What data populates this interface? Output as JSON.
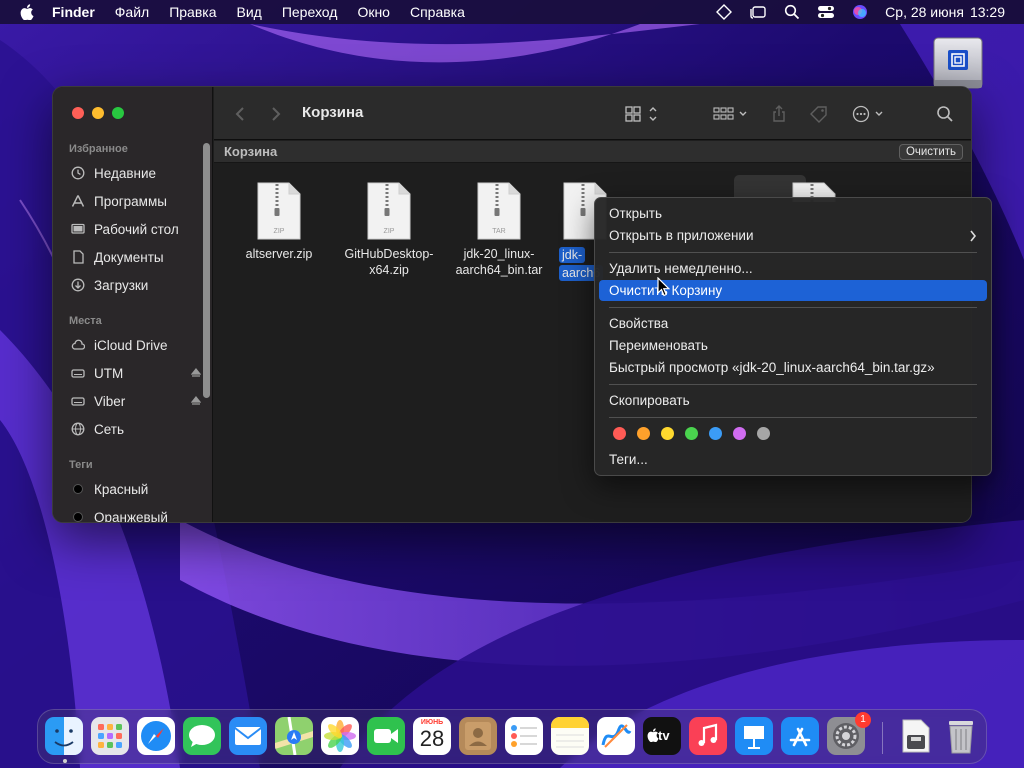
{
  "menubar": {
    "app_name": "Finder",
    "items": [
      "Файл",
      "Правка",
      "Вид",
      "Переход",
      "Окно",
      "Справка"
    ],
    "date": "Ср, 28 июня",
    "time": "13:29"
  },
  "window": {
    "title": "Корзина",
    "path_label": "Корзина",
    "empty_button": "Очистить"
  },
  "sidebar": {
    "favorites_header": "Избранное",
    "favorites": [
      "Недавние",
      "Программы",
      "Рабочий стол",
      "Документы",
      "Загрузки"
    ],
    "locations_header": "Места",
    "locations": [
      "iCloud Drive",
      "UTM",
      "Viber",
      "Сеть"
    ],
    "tags_header": "Теги",
    "tags": [
      "Красный",
      "Оранжевый"
    ]
  },
  "files": [
    {
      "line1": "altserver.zip",
      "line2": "",
      "ext": "ZIP"
    },
    {
      "line1": "GitHubDesktop-",
      "line2": "x64.zip",
      "ext": "ZIP"
    },
    {
      "line1": "jdk-20_linux-",
      "line2": "aarch64_bin.tar",
      "ext": "TAR"
    },
    {
      "line1": "jdk-",
      "line2": "aarch6",
      "ext": ""
    }
  ],
  "context_menu": {
    "open": "Открыть",
    "open_with": "Открыть в приложении",
    "delete_now": "Удалить немедленно...",
    "empty_trash": "Очистить Корзину",
    "get_info": "Свойства",
    "rename": "Переименовать",
    "quick_look": "Быстрый просмотр «jdk-20_linux-aarch64_bin.tar.gz»",
    "copy": "Скопировать",
    "tags": "Теги...",
    "tag_colors": [
      "#ff5b55",
      "#ffa12b",
      "#ffd92e",
      "#4ad34e",
      "#3b9cf6",
      "#d06cf0",
      "#a6a6a6"
    ]
  },
  "dock": {
    "calendar_month": "ИЮНЬ",
    "calendar_day": "28",
    "tv_label": "tv",
    "settings_badge": "1",
    "apps": [
      "finder-icon",
      "launchpad-icon",
      "safari-icon",
      "messages-icon",
      "mail-icon",
      "maps-icon",
      "photos-icon",
      "facetime-icon",
      "calendar-icon",
      "contacts-icon",
      "reminders-icon",
      "notes-icon",
      "freeform-icon",
      "apple-tv-icon",
      "music-icon",
      "keynote-icon",
      "app-store-icon",
      "system-settings-icon",
      "archive-utility-icon",
      "trash-icon"
    ]
  }
}
